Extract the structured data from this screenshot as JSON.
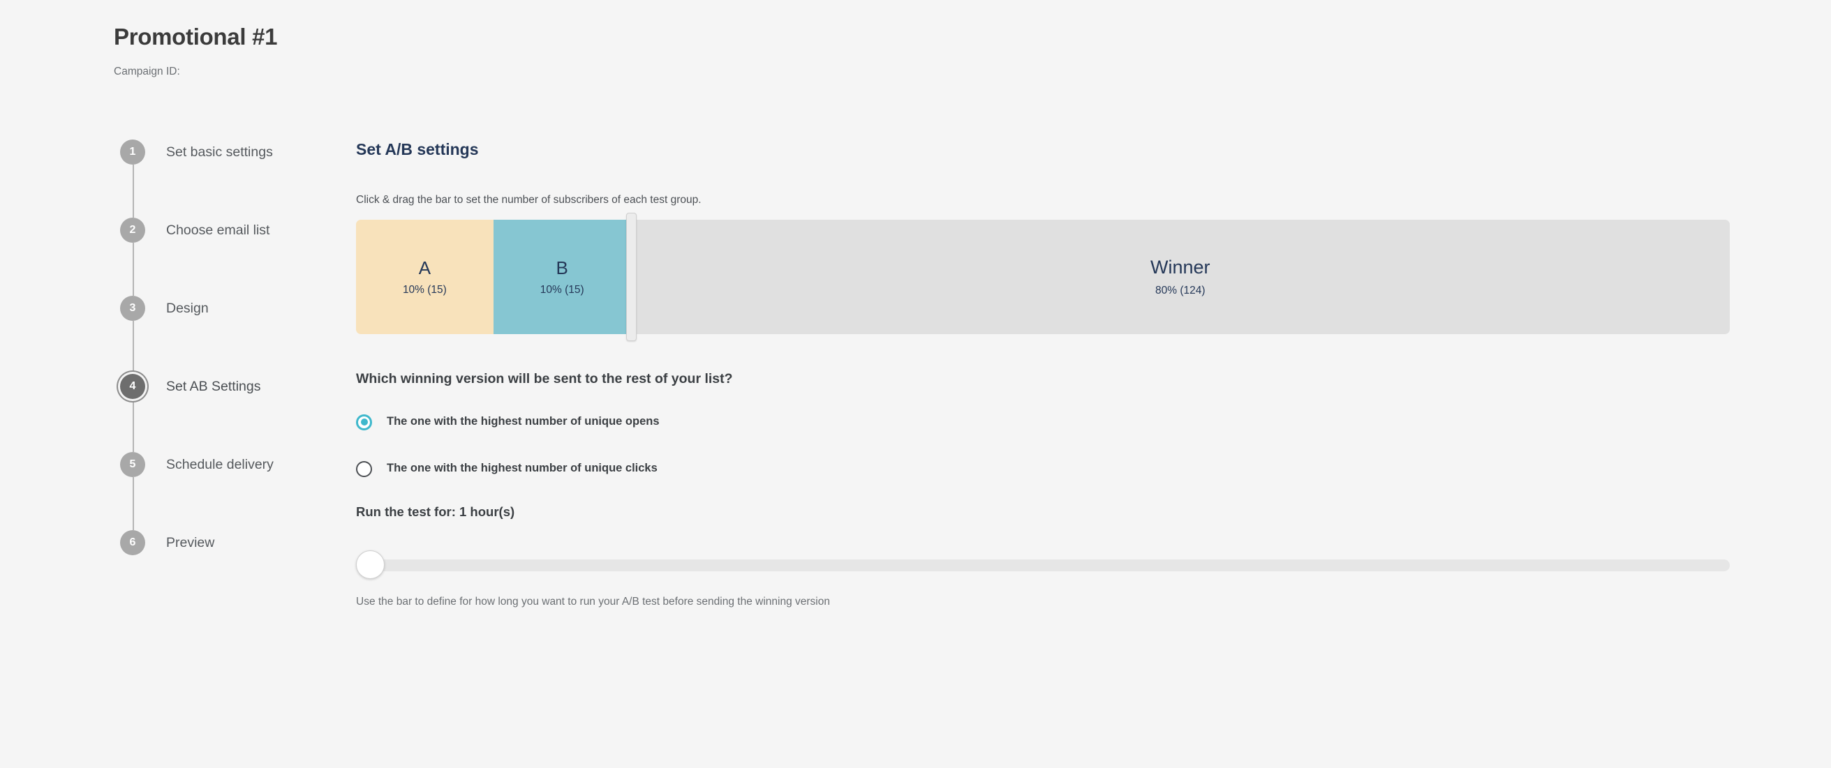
{
  "header": {
    "title": "Promotional #1",
    "campaign_id_label": "Campaign ID:"
  },
  "stepper": {
    "steps": [
      {
        "number": "1",
        "label": "Set basic settings",
        "active": false
      },
      {
        "number": "2",
        "label": "Choose email list",
        "active": false
      },
      {
        "number": "3",
        "label": "Design",
        "active": false
      },
      {
        "number": "4",
        "label": "Set AB Settings",
        "active": true
      },
      {
        "number": "5",
        "label": "Schedule delivery",
        "active": false
      },
      {
        "number": "6",
        "label": "Preview",
        "active": false
      }
    ]
  },
  "main": {
    "section_heading": "Set A/B settings",
    "hint": "Click & drag the bar to set the number of subscribers of each test group.",
    "split_bar": {
      "segments": [
        {
          "id": "a",
          "letter": "A",
          "percent": 10,
          "count": 15,
          "sub": "10% (15)",
          "color": "#f8e2bb"
        },
        {
          "id": "b",
          "letter": "B",
          "percent": 10,
          "count": 15,
          "sub": "10% (15)",
          "color": "#86c6d2"
        },
        {
          "id": "winner",
          "letter": "Winner",
          "percent": 80,
          "count": 124,
          "sub": "80% (124)",
          "color": "#e0e0e0"
        }
      ],
      "handle_position_percent": 20
    },
    "question": "Which winning version will be sent to the rest of your list?",
    "radio_options": [
      {
        "label": "The one with the highest number of unique opens",
        "checked": true
      },
      {
        "label": "The one with the highest number of unique clicks",
        "checked": false
      }
    ],
    "duration": {
      "prefix": "Run the test for: ",
      "value": "1 hour(s)",
      "slider_value_percent": 0,
      "help": "Use the bar to define for how long you want to run your A/B test before sending the winning version"
    }
  },
  "colors": {
    "background": "#f5f5f5",
    "accent_teal": "#3fb8cc",
    "heading_navy": "#253858",
    "segment_a": "#f8e2bb",
    "segment_b": "#86c6d2",
    "segment_winner": "#e0e0e0",
    "step_active": "#6e6e6e",
    "step_inactive": "#a8a8a8"
  }
}
